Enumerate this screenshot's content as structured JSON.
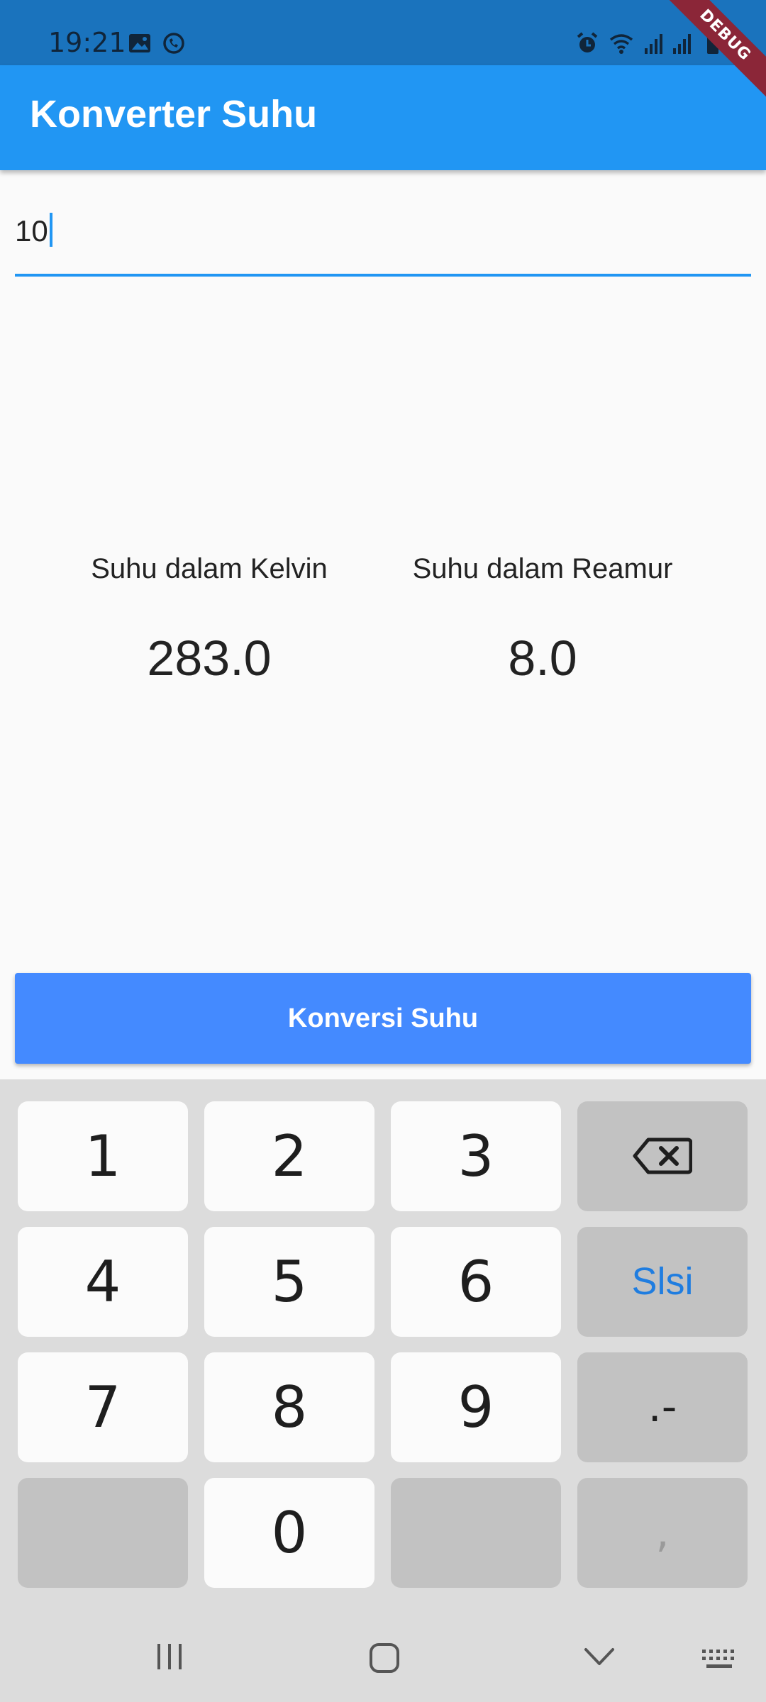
{
  "status_bar": {
    "time": "19:21",
    "left_icons": [
      "image-icon",
      "whatsapp-icon"
    ],
    "right_icons": [
      "alarm-icon",
      "wifi-icon",
      "signal-icon",
      "signal-icon-2",
      "battery-icon"
    ]
  },
  "debug_banner": "DEBUG",
  "app_bar": {
    "title": "Konverter Suhu"
  },
  "input": {
    "value": "10"
  },
  "results": {
    "kelvin": {
      "label": "Suhu dalam Kelvin",
      "value": "283.0"
    },
    "reamur": {
      "label": "Suhu dalam Reamur",
      "value": "8.0"
    }
  },
  "convert_button": {
    "label": "Konversi Suhu"
  },
  "keyboard": {
    "keys": [
      {
        "label": "1"
      },
      {
        "label": "2"
      },
      {
        "label": "3"
      },
      {
        "label": "",
        "icon": "backspace-icon"
      },
      {
        "label": "4"
      },
      {
        "label": "5"
      },
      {
        "label": "6"
      },
      {
        "label": "Slsi"
      },
      {
        "label": "7"
      },
      {
        "label": "8"
      },
      {
        "label": "9"
      },
      {
        "label": ".-"
      },
      {
        "label": ""
      },
      {
        "label": "0"
      },
      {
        "label": ""
      },
      {
        "label": ","
      }
    ]
  },
  "nav_bar": {
    "icons": [
      "recent-apps-icon",
      "home-icon",
      "back-icon",
      "keyboard-icon"
    ]
  },
  "colors": {
    "status_bar": "#1a73bd",
    "app_bar": "#2196f3",
    "button": "#448aff",
    "accent_text": "#1f7de0"
  }
}
